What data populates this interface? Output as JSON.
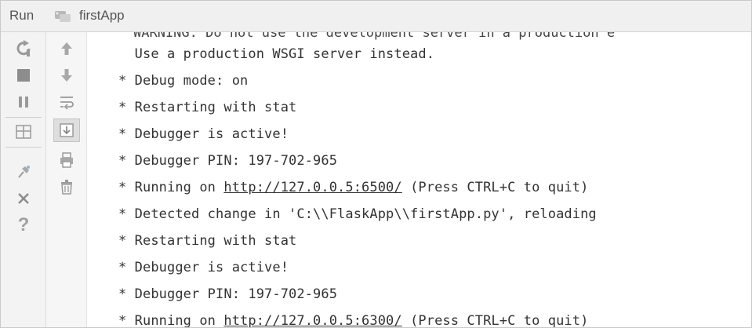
{
  "window": {
    "run_label": "Run",
    "app_name": "firstApp",
    "app_icon": "python-run-config-icon"
  },
  "left_toolbar": {
    "buttons": [
      {
        "name": "rerun-icon"
      },
      {
        "name": "stop-icon"
      },
      {
        "name": "pause-icon"
      },
      {
        "name": "restore-layout-icon"
      },
      {
        "name": "pin-tab-icon"
      },
      {
        "name": "close-icon"
      },
      {
        "name": "help-icon",
        "glyph": "?"
      }
    ]
  },
  "right_toolbar": {
    "buttons": [
      {
        "name": "up-arrow-icon"
      },
      {
        "name": "down-arrow-icon"
      },
      {
        "name": "soft-wrap-icon"
      },
      {
        "name": "scroll-to-end-icon"
      },
      {
        "name": "print-icon"
      },
      {
        "name": "trash-icon"
      }
    ]
  },
  "console": {
    "partial_line": "WARNING: Do not use the development server in a production e",
    "lines": [
      {
        "text": "  Use a production WSGI server instead."
      },
      {
        "text": "* Debug mode: on"
      },
      {
        "text": "* Restarting with stat"
      },
      {
        "text": "* Debugger is active!"
      },
      {
        "text": "* Debugger PIN: 197-702-965"
      },
      {
        "prefix": "* Running on ",
        "link": "http://127.0.0.5:6500/",
        "suffix": " (Press CTRL+C to quit)"
      },
      {
        "text": "* Detected change in 'C:\\\\FlaskApp\\\\firstApp.py', reloading"
      },
      {
        "text": "* Restarting with stat"
      },
      {
        "text": "* Debugger is active!"
      },
      {
        "text": "* Debugger PIN: 197-702-965"
      },
      {
        "prefix": "* Running on ",
        "link": "http://127.0.0.5:6300/",
        "suffix": " (Press CTRL+C to quit)"
      }
    ]
  }
}
